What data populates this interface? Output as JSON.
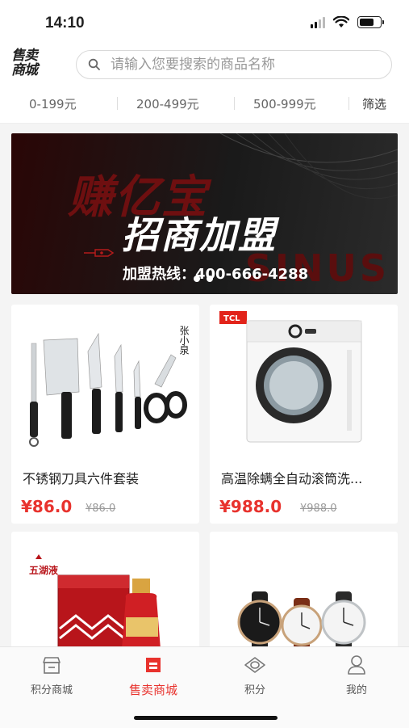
{
  "status_bar": {
    "time": "14:10"
  },
  "header": {
    "logo_line1": "售卖",
    "logo_line2": "商城",
    "search_placeholder": "请输入您要搜索的商品名称"
  },
  "filters": {
    "ranges": [
      "0-199元",
      "200-499元",
      "500-999元"
    ],
    "filter_label": "筛选"
  },
  "banner": {
    "brand_text": "赚亿宝",
    "headline": "招商加盟",
    "hotline": "加盟热线：400-666-4288",
    "bg_text": "SINUS",
    "active_dot": 0,
    "dot_count": 2
  },
  "products": [
    {
      "title": "不锈钢刀具六件套装",
      "price": "¥86.0",
      "old_price": "¥86.0",
      "image": "knife-set",
      "badge": "张小泉"
    },
    {
      "title": "高温除螨全自动滚筒洗...",
      "price": "¥988.0",
      "old_price": "¥988.0",
      "image": "washing-machine",
      "badge": "TCL"
    },
    {
      "title": "",
      "price": "",
      "old_price": "",
      "image": "liquor-box",
      "badge": "五湖液"
    },
    {
      "title": "",
      "price": "",
      "old_price": "",
      "image": "watches",
      "badge": ""
    }
  ],
  "tabbar": {
    "items": [
      {
        "label": "积分商城",
        "icon": "store-icon"
      },
      {
        "label": "售卖商城",
        "icon": "shop-active-icon"
      },
      {
        "label": "积分",
        "icon": "points-icon"
      },
      {
        "label": "我的",
        "icon": "profile-icon"
      }
    ],
    "active_index": 1
  },
  "colors": {
    "accent": "#e8322d",
    "banner_dark": "#1a1a1a"
  }
}
